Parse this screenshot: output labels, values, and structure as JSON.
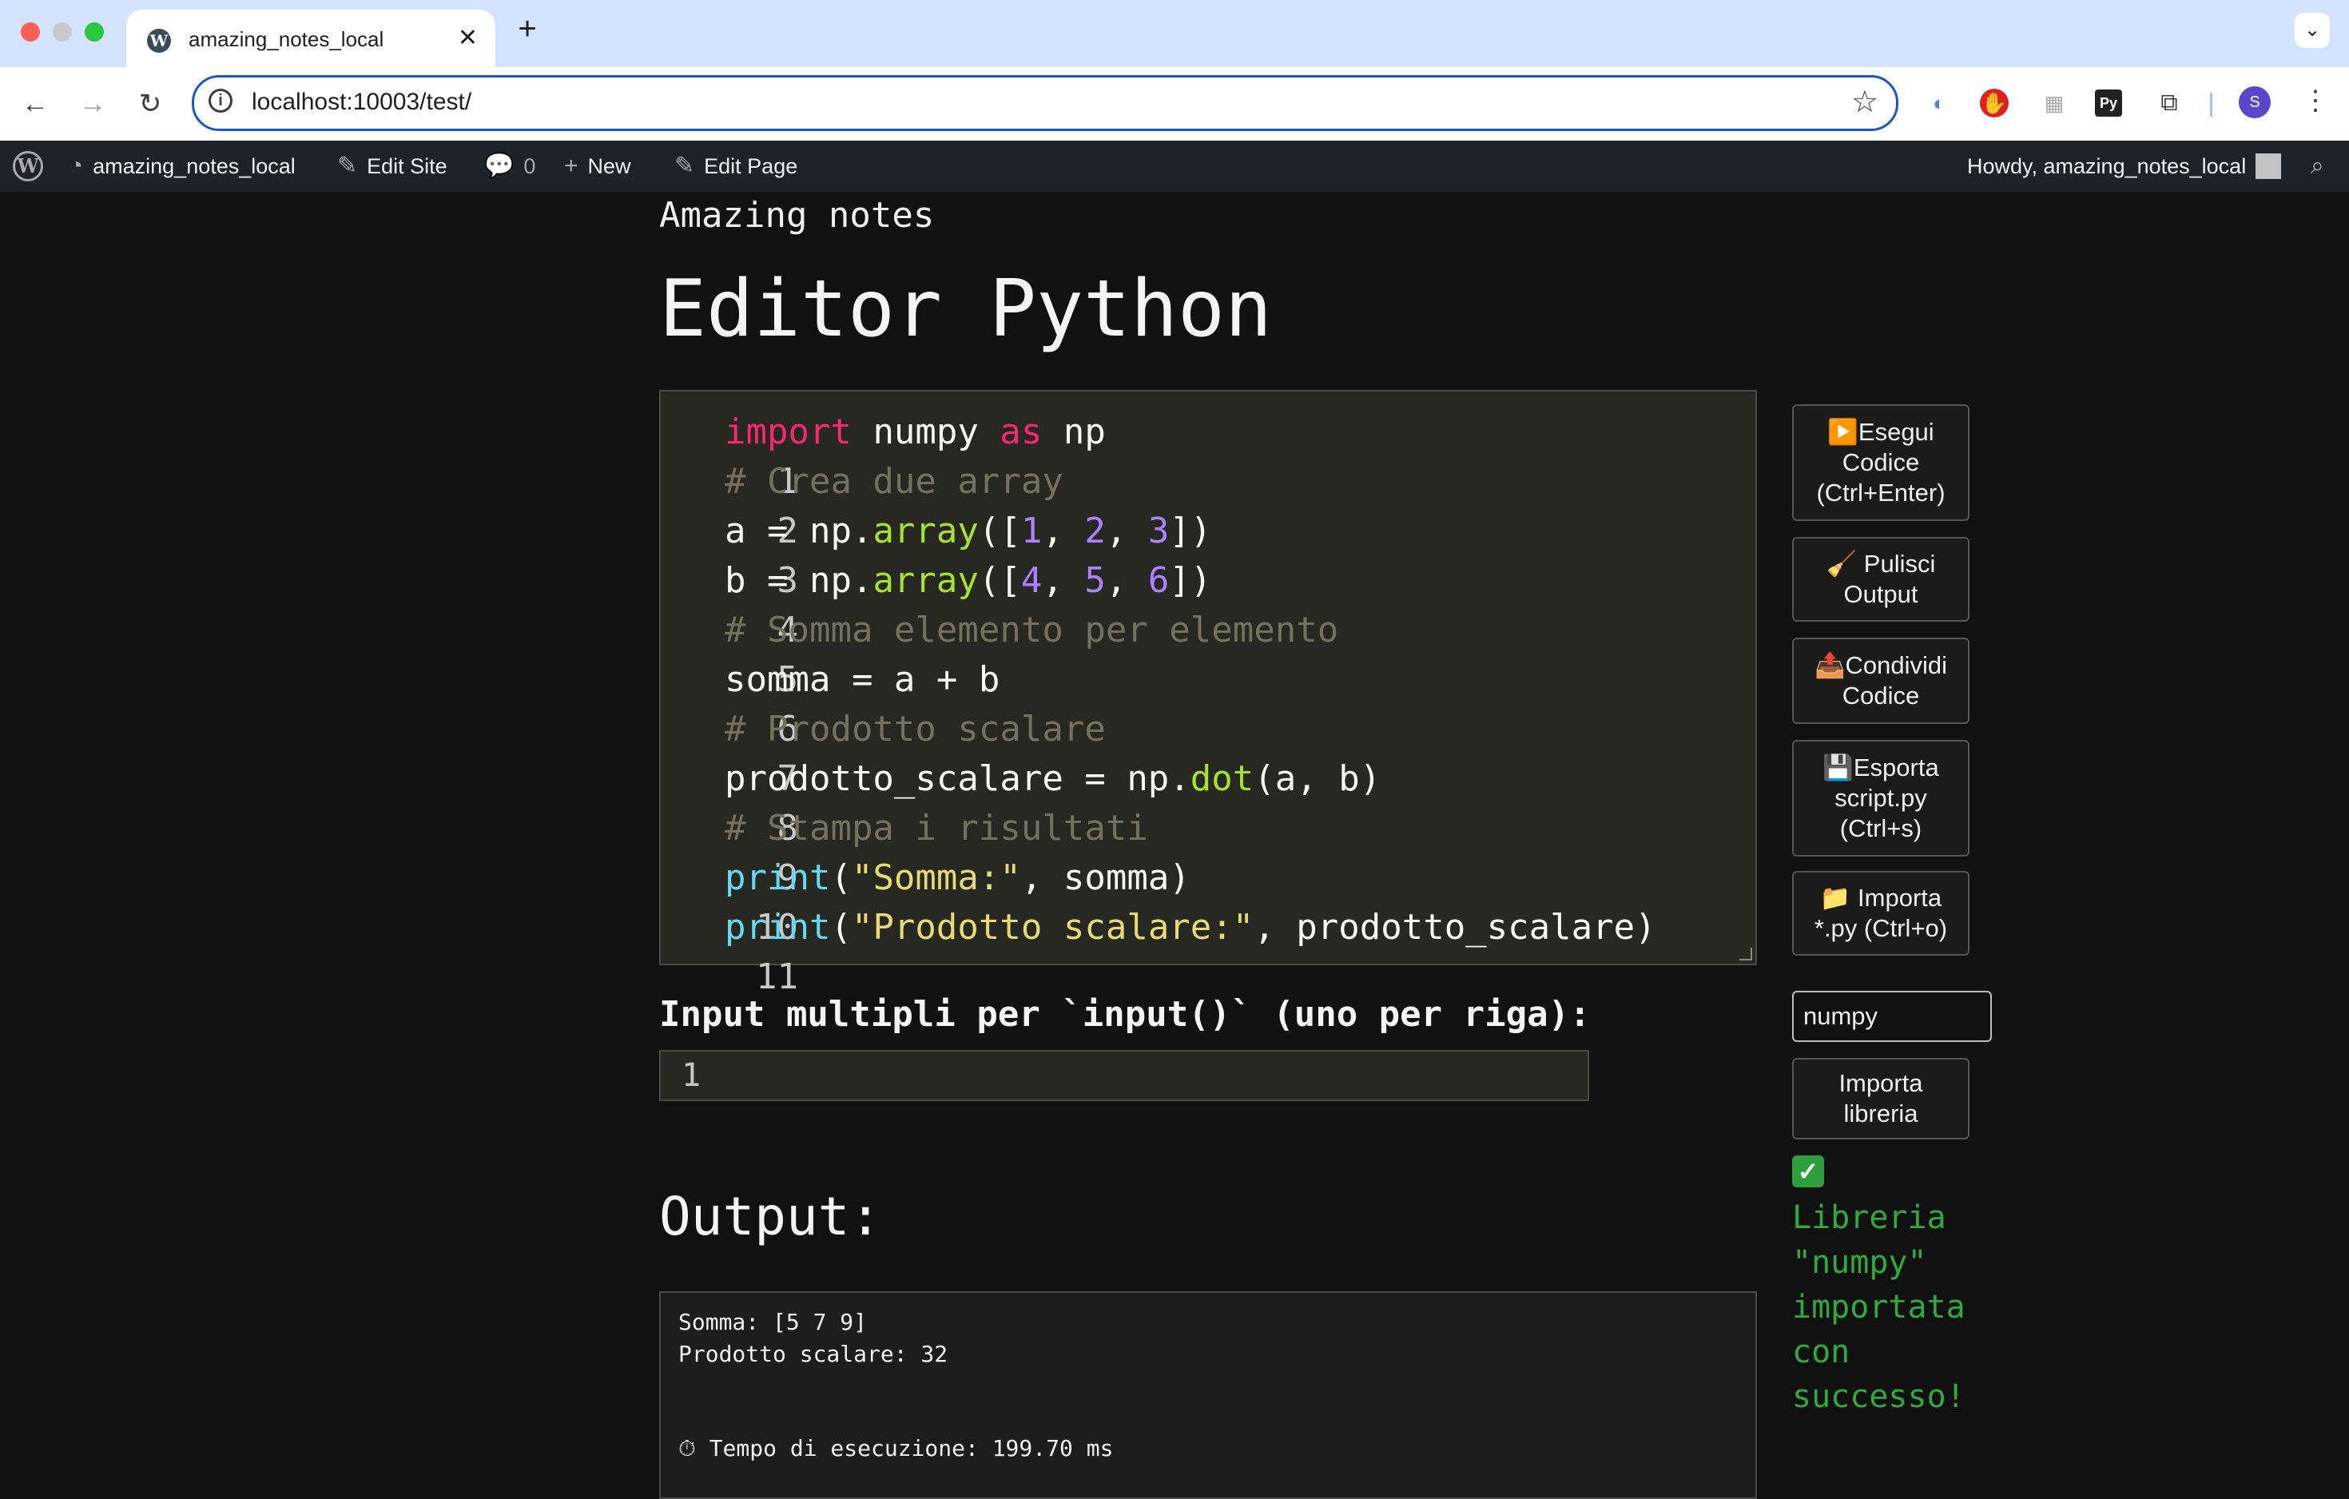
{
  "browser": {
    "tab_title": "amazing_notes_local",
    "tab_close": "✕",
    "new_tab": "+",
    "url": "localhost:10003/test/",
    "profile_initial": "S"
  },
  "admin_bar": {
    "site_name": "amazing_notes_local",
    "edit_site": "Edit Site",
    "comments_count": "0",
    "new_label": "New",
    "edit_page": "Edit Page",
    "howdy": "Howdy, amazing_notes_local"
  },
  "page": {
    "site_title": "Amazing notes",
    "title": "Editor Python"
  },
  "editor": {
    "lines": [
      {
        "n": "1"
      },
      {
        "n": "2"
      },
      {
        "n": "3"
      },
      {
        "n": "4"
      },
      {
        "n": "5"
      },
      {
        "n": "6"
      },
      {
        "n": "7"
      },
      {
        "n": "8"
      },
      {
        "n": "9"
      },
      {
        "n": "10"
      },
      {
        "n": "11"
      }
    ],
    "tokens": {
      "l1_import": "import",
      "l1_mod": " numpy ",
      "l1_as": "as",
      "l1_alias": " np",
      "l2": "# Crea due array",
      "l3_a": "a = np.",
      "l3_fn": "array",
      "l3_open": "([",
      "l3_n1": "1",
      "l3_c1": ", ",
      "l3_n2": "2",
      "l3_c2": ", ",
      "l3_n3": "3",
      "l3_close": "])",
      "l4_a": "b = np.",
      "l4_fn": "array",
      "l4_open": "([",
      "l4_n1": "4",
      "l4_c1": ", ",
      "l4_n2": "5",
      "l4_c2": ", ",
      "l4_n3": "6",
      "l4_close": "])",
      "l5": "# Somma elemento per elemento",
      "l6": "somma = a + b",
      "l7": "# Prodotto scalare",
      "l8_a": "prodotto_scalare = np.",
      "l8_fn": "dot",
      "l8_b": "(a, b)",
      "l9": "# Stampa i risultati",
      "l10_fn": "print",
      "l10_open": "(",
      "l10_str": "\"Somma:\"",
      "l10_rest": ", somma)",
      "l11_fn": "print",
      "l11_open": "(",
      "l11_str": "\"Prodotto scalare:\"",
      "l11_rest": ", prodotto_scalare)"
    }
  },
  "input_section": {
    "label": "Input multipli per `input()` (uno per riga):",
    "value": "1"
  },
  "output": {
    "title": "Output:",
    "line1": "Somma: [5 7 9]",
    "line2": "Prodotto scalare: 32",
    "timing": "⏱ Tempo di esecuzione: 199.70 ms"
  },
  "sidebar": {
    "run": "▶️Esegui Codice (Ctrl+Enter)",
    "clear": "🧹 Pulisci Output",
    "share": "📤Condividi Codice",
    "export": "💾Esporta script.py (Ctrl+s)",
    "import_file": "📁 Importa *.py (Ctrl+o)",
    "library_value": "numpy",
    "import_library": "Importa libreria",
    "status_check": "✓",
    "status_message": "Libreria \"numpy\" importata con successo!"
  },
  "colors": {
    "keyword": "#f92672",
    "comment": "#75715e",
    "function": "#a6e22e",
    "builtin": "#66d9ef",
    "number": "#ae81ff",
    "string": "#e6db74",
    "success": "#31a93f"
  }
}
